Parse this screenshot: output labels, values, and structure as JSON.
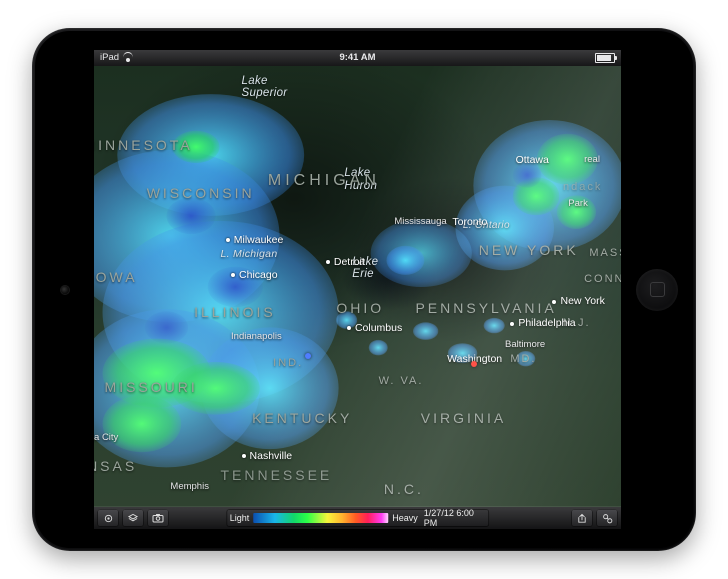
{
  "device": {
    "label": "iPad"
  },
  "status": {
    "left_label": "iPad",
    "time": "9:41 AM"
  },
  "map": {
    "lakes": {
      "superior": "Lake\nSuperior",
      "michigan": "L. Michigan",
      "huron": "Lake\nHuron",
      "erie": "Lake\nErie",
      "ontario": "L. Ontario"
    },
    "states": {
      "minnesota": "MINNESOTA",
      "wisconsin": "WISCONSIN",
      "michigan": "MICHIGAN",
      "iowa": "IOWA",
      "illinois": "ILLINOIS",
      "indiana": "IND.",
      "ohio": "OHIO",
      "pennsylvania": "PENNSYLVANIA",
      "newyork": "NEW YORK",
      "mass": "MASS.",
      "conn": "CONN.",
      "nj": "N.J.",
      "md": "MD.",
      "wva": "W. VA.",
      "virginia": "VIRGINIA",
      "kentucky": "KENTUCKY",
      "tennessee": "TENNESSEE",
      "missouri": "MISSOURI",
      "kansas": "KANSAS",
      "nc": "N.C.",
      "ndack": "ndack"
    },
    "cities": {
      "milwaukee": "Milwaukee",
      "chicago": "Chicago",
      "detroit": "Detroit",
      "indianapolis": "Indianapolis",
      "columbus": "Columbus",
      "mississauga": "Mississauga",
      "toronto": "Toronto",
      "ottawa": "Ottawa",
      "real": "real",
      "newyorkc": "New York",
      "philadelphia": "Philadelphia",
      "baltimore": "Baltimore",
      "washington": "Washington",
      "nashville": "Nashville",
      "memphis": "Memphis",
      "nacity": "na City",
      "park": "Park"
    }
  },
  "legend": {
    "left": "Light",
    "right": "Heavy",
    "timestamp": "1/27/12 6:00 PM"
  },
  "icons": {
    "locate": "locate-icon",
    "layers": "layers-icon",
    "camera": "camera-icon",
    "share": "share-icon",
    "settings": "settings-icon"
  }
}
